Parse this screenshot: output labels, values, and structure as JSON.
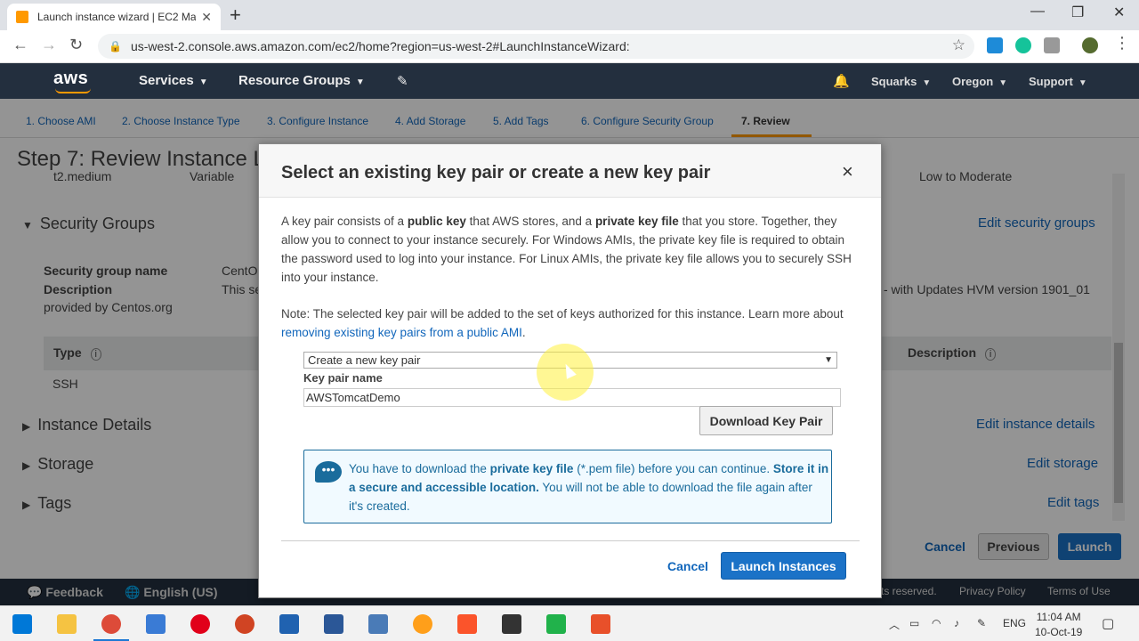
{
  "browser": {
    "tab_title": "Launch instance wizard | EC2 Ma",
    "url": "us-west-2.console.aws.amazon.com/ec2/home?region=us-west-2#LaunchInstanceWizard:"
  },
  "aws_nav": {
    "logo": "aws",
    "services": "Services",
    "resource_groups": "Resource Groups",
    "account": "Squarks",
    "region": "Oregon",
    "support": "Support"
  },
  "wizard_steps": [
    "1. Choose AMI",
    "2. Choose Instance Type",
    "3. Configure Instance",
    "4. Add Storage",
    "5. Add Tags",
    "6. Configure Security Group",
    "7. Review"
  ],
  "page": {
    "title": "Step 7: Review Instance L",
    "row_instance_type": "t2.medium",
    "row_ecu": "Variable",
    "row_network": "Low to Moderate",
    "security_groups_heading": "Security Groups",
    "edit_security_groups": "Edit security groups",
    "sg_name_label": "Security group name",
    "sg_name_value": "CentO",
    "sg_desc_label": "Description",
    "sg_desc_value": "This se",
    "sg_desc_right": "- with Updates HVM version 1901_01",
    "sg_desc_cont": "provided by Centos.org",
    "col_type": "Type",
    "col_description": "Description",
    "row_type": "SSH",
    "instance_details": "Instance Details",
    "edit_instance_details": "Edit instance details",
    "storage": "Storage",
    "edit_storage": "Edit storage",
    "tags": "Tags",
    "edit_tags": "Edit tags",
    "cancel": "Cancel",
    "previous": "Previous",
    "launch": "Launch"
  },
  "footer": {
    "feedback": "Feedback",
    "language": "English (US)",
    "rights": "ts reserved.",
    "privacy": "Privacy Policy",
    "terms": "Terms of Use"
  },
  "modal": {
    "title": "Select an existing key pair or create a new key pair",
    "close": "×",
    "p1_a": "A key pair consists of a ",
    "p1_b": "public key",
    "p1_c": " that AWS stores, and a ",
    "p1_d": "private key file",
    "p1_e": " that you store. Together, they allow you to connect to your instance securely. For Windows AMIs, the private key file is required to obtain the password used to log into your instance. For Linux AMIs, the private key file allows you to securely SSH into your instance.",
    "p2_a": "Note: The selected key pair will be added to the set of keys authorized for this instance. Learn more about ",
    "p2_link": "removing existing key pairs from a public AMI",
    "p2_b": ".",
    "select_value": "Create a new key pair",
    "key_pair_label": "Key pair name",
    "key_pair_value": "AWSTomcatDemo",
    "download_button": "Download Key Pair",
    "info_a": "You have to download the ",
    "info_b": "private key file",
    "info_c": " (*.pem file) before you can continue. ",
    "info_d": "Store it in a secure and accessible location.",
    "info_e": " You will not be able to download the file again after it's created.",
    "cancel": "Cancel",
    "launch": "Launch Instances"
  },
  "taskbar": {
    "lang": "ENG",
    "time": "11:04 AM",
    "date": "10-Oct-19"
  },
  "colors": {
    "aws_dark": "#232f3e",
    "aws_orange": "#ff9900",
    "link_blue": "#1166bb",
    "primary_button": "#1b72c7"
  }
}
